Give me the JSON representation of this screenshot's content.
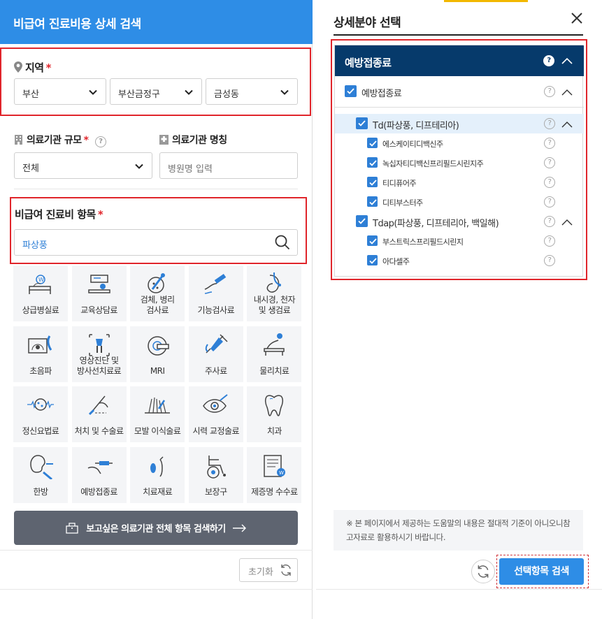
{
  "left": {
    "header_title": "비급여 진료비용 상세 검색",
    "region": {
      "label": "지역",
      "required": "*",
      "selects": [
        "부산",
        "부산금정구",
        "금성동"
      ]
    },
    "scale": {
      "label": "의료기관 규모",
      "required": "*",
      "help": "?",
      "value": "전체"
    },
    "name": {
      "label": "의료기관 명칭",
      "placeholder": "병원명 입력"
    },
    "item": {
      "label": "비급여 진료비 항목",
      "required": "*",
      "search_value": "파상풍"
    },
    "categories": [
      {
        "label": "상급병실료",
        "icon": "hospital-bed-icon"
      },
      {
        "label": "교육상담료",
        "icon": "counseling-icon"
      },
      {
        "label": "검체, 병리\n검사료",
        "icon": "microscope-test-icon"
      },
      {
        "label": "기능검사료",
        "icon": "function-test-icon"
      },
      {
        "label": "내시경, 천자\n및 생검료",
        "icon": "endoscope-icon"
      },
      {
        "label": "초음파",
        "icon": "ultrasound-icon"
      },
      {
        "label": "영상진단 및\n방사선치료료",
        "icon": "xray-icon"
      },
      {
        "label": "MRI",
        "icon": "mri-icon"
      },
      {
        "label": "주사료",
        "icon": "syringe-icon"
      },
      {
        "label": "물리치료",
        "icon": "physiotherapy-icon"
      },
      {
        "label": "정신요법료",
        "icon": "brain-wave-icon"
      },
      {
        "label": "처치 및 수술료",
        "icon": "surgery-icon"
      },
      {
        "label": "모발 이식술료",
        "icon": "hair-transplant-icon"
      },
      {
        "label": "시력 교정술료",
        "icon": "eye-correction-icon"
      },
      {
        "label": "치과",
        "icon": "tooth-icon"
      },
      {
        "label": "한방",
        "icon": "acupuncture-icon"
      },
      {
        "label": "예방접종료",
        "icon": "vaccination-icon"
      },
      {
        "label": "치료재료",
        "icon": "treatment-material-icon"
      },
      {
        "label": "보장구",
        "icon": "wheelchair-icon"
      },
      {
        "label": "제증명 수수료",
        "icon": "certificate-icon"
      }
    ],
    "all_search_button": "보고싶은 의료기관 전체 항목 검색하기",
    "reset_button": "초기화"
  },
  "right": {
    "title": "상세분야 선택",
    "tree": {
      "header": "예방접종료",
      "root": "예방접종료",
      "groups": [
        {
          "label": "Td(파상풍, 디프테리아)",
          "items": [
            "에스케이티디백신주",
            "녹십자티디백신프리필드시린지주",
            "티디퓨어주",
            "디티부스터주"
          ]
        },
        {
          "label": "Tdap(파상풍, 디프테리아, 백일해)",
          "items": [
            "부스트릭스프리필드시린지",
            "아다셀주"
          ]
        }
      ]
    },
    "notice": "※ 본 페이지에서 제공하는 도움말의 내용은 절대적 기준이 아니오니참고자료로 활용하시기 바랍니다.",
    "submit_button": "선택항목 검색"
  },
  "colors": {
    "accent": "#2e8de6",
    "tree_header": "#063a6b",
    "highlight": "#e4f0fb",
    "checkbox": "#2e7fd6",
    "required": "#e0252b"
  }
}
